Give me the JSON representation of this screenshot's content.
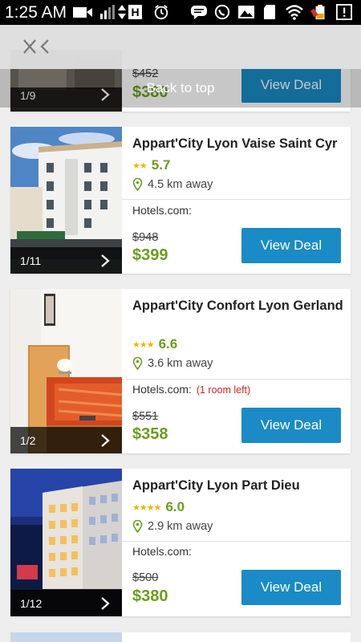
{
  "status_bar": {
    "time": "1:25 AM",
    "badge_letter": "H",
    "icons": [
      "video-icon",
      "signal-bars-icon",
      "data-arrows-icon",
      "alarm-icon",
      "chat-icon",
      "whatsapp-icon",
      "gallery-icon",
      "sd-card-icon",
      "wifi-icon",
      "battery-icon",
      "alert-icon"
    ]
  },
  "top_bar": {
    "close_icon": "close-collapse-icon"
  },
  "back_to_top": {
    "label": "Back to top"
  },
  "partial_card": {
    "photo_counter": "1/9",
    "old_price": "$452",
    "new_price": "$380",
    "deal_label": "View Deal"
  },
  "hotels": [
    {
      "name": "Appart'City Lyon Vaise Saint Cyr",
      "stars": 2,
      "star_text": "★★",
      "score": "5.7",
      "distance": "4.5 km away",
      "provider": "Hotels.com:",
      "availability": "",
      "old_price": "$948",
      "new_price": "$399",
      "photo_counter": "1/11",
      "deal_label": "View Deal"
    },
    {
      "name": "Appart'City Confort Lyon Gerland",
      "stars": 3,
      "star_text": "★★★",
      "score": "6.6",
      "distance": "3.6 km away",
      "provider": "Hotels.com:",
      "availability": "(1 room left)",
      "old_price": "$551",
      "new_price": "$358",
      "photo_counter": "1/2",
      "deal_label": "View Deal"
    },
    {
      "name": "Appart'City Lyon Part Dieu",
      "stars": 4,
      "star_text": "★★★★",
      "score": "6.0",
      "distance": "2.9 km away",
      "provider": "Hotels.com:",
      "availability": "",
      "old_price": "$500",
      "new_price": "$380",
      "photo_counter": "1/12",
      "deal_label": "View Deal"
    }
  ],
  "colors": {
    "accent_button": "#1a8bc6",
    "price_green": "#6a9e1f",
    "star_yellow": "#f4b400",
    "availability_red": "#c62828"
  }
}
